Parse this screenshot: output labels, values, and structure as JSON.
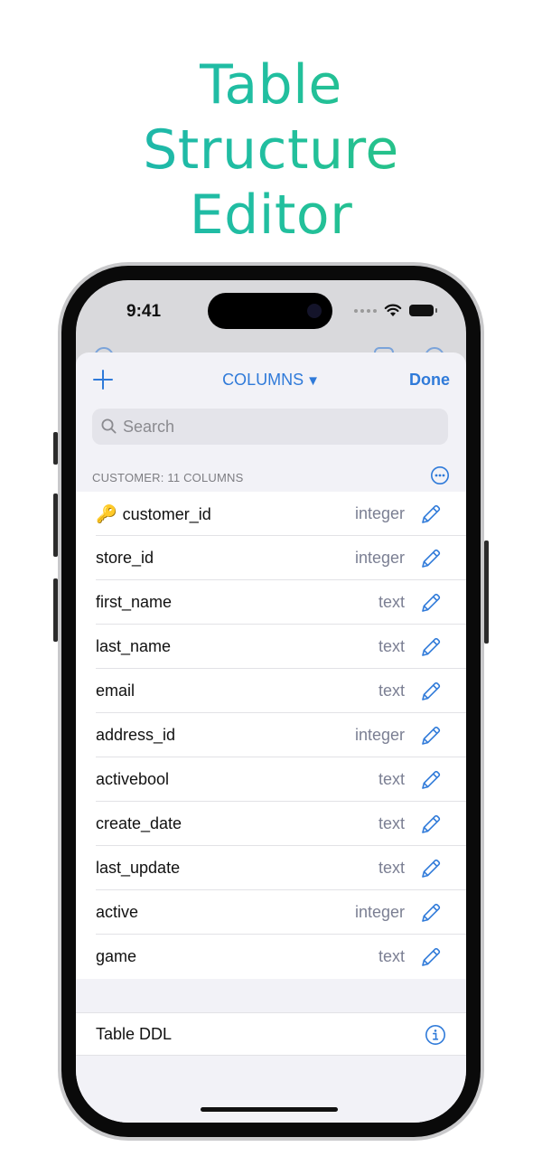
{
  "headline": {
    "line1": "Table",
    "line2": "Structure",
    "line3": "Editor"
  },
  "status_bar": {
    "time": "9:41",
    "icons": [
      "cellular-dots-icon",
      "wifi-icon",
      "battery-icon"
    ]
  },
  "nav": {
    "add_icon": "plus-icon",
    "title": "COLUMNS",
    "title_caret": "▼",
    "done_label": "Done"
  },
  "search": {
    "placeholder": "Search",
    "value": ""
  },
  "section": {
    "header": "CUSTOMER: 11 COLUMNS",
    "more_icon": "ellipsis-circle-icon"
  },
  "columns": [
    {
      "name": "customer_id",
      "type": "integer",
      "primary_key": true
    },
    {
      "name": "store_id",
      "type": "integer"
    },
    {
      "name": "first_name",
      "type": "text"
    },
    {
      "name": "last_name",
      "type": "text"
    },
    {
      "name": "email",
      "type": "text"
    },
    {
      "name": "address_id",
      "type": "integer"
    },
    {
      "name": "activebool",
      "type": "text"
    },
    {
      "name": "create_date",
      "type": "text"
    },
    {
      "name": "last_update",
      "type": "text"
    },
    {
      "name": "active",
      "type": "integer"
    },
    {
      "name": "game",
      "type": "text"
    }
  ],
  "ddl": {
    "label": "Table DDL",
    "icon": "info-circle-icon"
  },
  "colors": {
    "accent": "#2f7ad9",
    "headline_gradient_start": "#1bb0b3",
    "headline_gradient_end": "#2bc46f",
    "type_text": "#7b7f93",
    "sheet_background": "#f2f2f7"
  }
}
